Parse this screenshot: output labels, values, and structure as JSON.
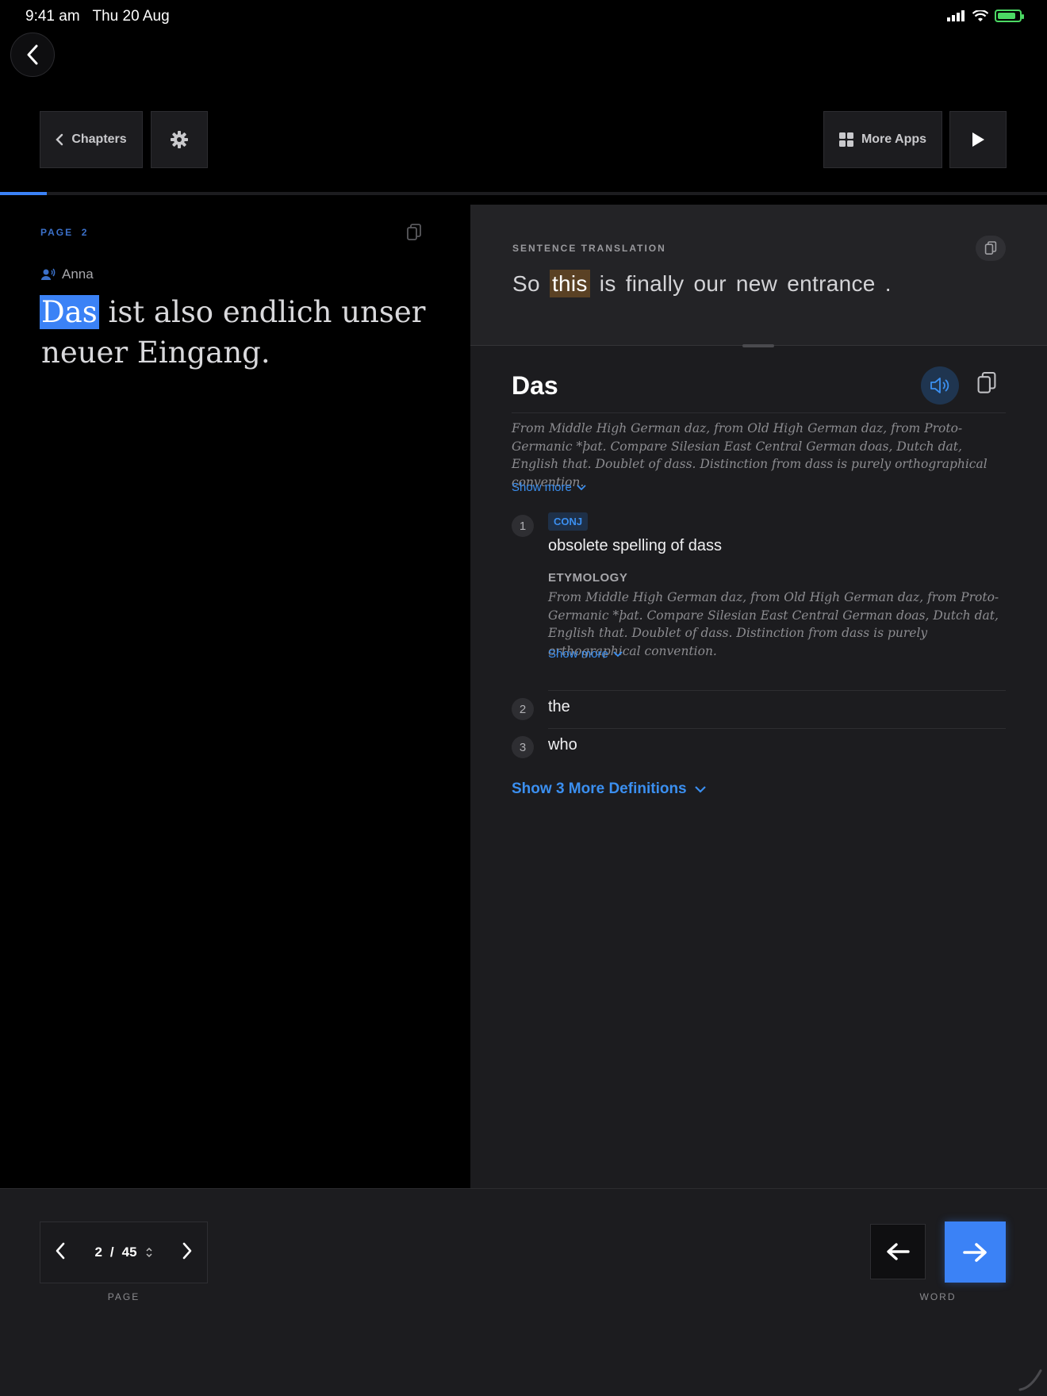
{
  "status": {
    "time": "9:41 am",
    "date": "Thu 20 Aug"
  },
  "toolbar": {
    "chapters_label": "Chapters",
    "more_apps_label": "More Apps"
  },
  "reading": {
    "progress": 0.045
  },
  "left": {
    "page_label": "PAGE",
    "page_number": "2",
    "speaker": "Anna",
    "highlighted_word": "Das",
    "rest_text": " ist also endlich unser neuer Eingang",
    "end_punct": "."
  },
  "translation": {
    "label": "SENTENCE TRANSLATION",
    "before": "So ",
    "highlight": "this",
    "after": " is finally our new entrance",
    "end_punct": "."
  },
  "word": {
    "headword": "Das",
    "etymology": "From Middle High German daz, from Old High German daz, from Proto-Germanic *þat. Compare Silesian East Central German doas, Dutch dat, English that. Doublet of dass. Distinction from dass is purely orthographical convention.",
    "show_more": "Show more",
    "definitions": [
      {
        "num": "1",
        "pos": "CONJ",
        "text": "obsolete spelling of dass",
        "etym_label": "ETYMOLOGY",
        "etym": "From Middle High German daz, from Old High German daz, from Proto-Germanic *þat. Compare Silesian East Central German doas, Dutch dat, English that. Doublet of dass. Distinction from dass is purely orthographical convention.",
        "show_more": "Show more"
      },
      {
        "num": "2",
        "text": "the"
      },
      {
        "num": "3",
        "text": "who"
      }
    ],
    "more_defs": "Show 3 More Definitions"
  },
  "pager": {
    "current": "2",
    "separator": "/",
    "total": "45",
    "label": "PAGE"
  },
  "word_nav": {
    "label": "WORD"
  },
  "colors": {
    "accent": "#3b82f6",
    "link": "#3b8ff0",
    "highlight_translation": "#5a4124"
  }
}
